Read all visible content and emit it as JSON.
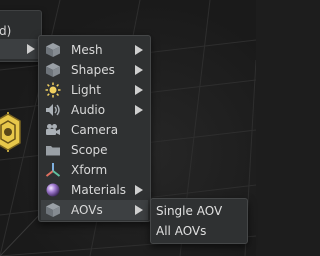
{
  "parent_menu": {
    "partial_label": "d)",
    "arrow_icon": "chevron-right-icon"
  },
  "create_menu": {
    "items": [
      {
        "label": "Mesh",
        "icon": "cube-icon",
        "has_submenu": true
      },
      {
        "label": "Shapes",
        "icon": "shapes-cube-icon",
        "has_submenu": true
      },
      {
        "label": "Light",
        "icon": "light-icon",
        "has_submenu": true
      },
      {
        "label": "Audio",
        "icon": "speaker-icon",
        "has_submenu": true
      },
      {
        "label": "Camera",
        "icon": "camera-icon",
        "has_submenu": false
      },
      {
        "label": "Scope",
        "icon": "folder-icon",
        "has_submenu": false
      },
      {
        "label": "Xform",
        "icon": "axes-icon",
        "has_submenu": false
      },
      {
        "label": "Materials",
        "icon": "material-sphere-icon",
        "has_submenu": true
      },
      {
        "label": "AOVs",
        "icon": "aov-cube-icon",
        "has_submenu": true
      }
    ],
    "active_item": "AOVs"
  },
  "aov_menu": {
    "items": [
      {
        "label": "Single AOV"
      },
      {
        "label": "All AOVs"
      }
    ]
  },
  "colors": {
    "menu_bg": "#2f3132",
    "hover_bg": "#3d4042",
    "light_gizmo": "#f0d060"
  }
}
